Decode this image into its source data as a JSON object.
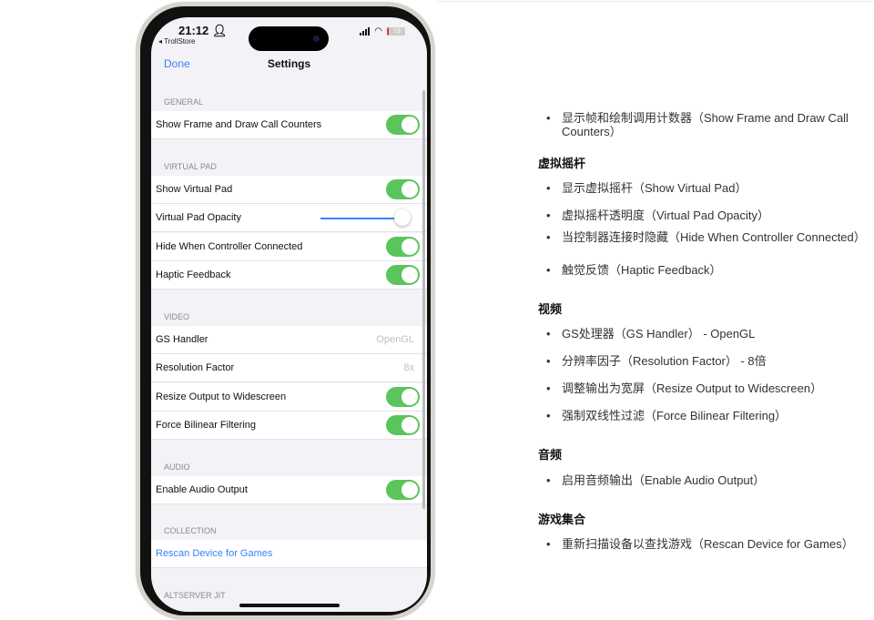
{
  "status": {
    "time": "21:12",
    "back": "◂ TrollStore",
    "battery": "13"
  },
  "nav": {
    "done": "Done",
    "title": "Settings"
  },
  "sections": [
    {
      "header": "GENERAL",
      "rows": [
        {
          "label": "Show Frame and Draw Call Counters",
          "toggle": true
        }
      ]
    },
    {
      "header": "VIRTUAL PAD",
      "rows": [
        {
          "label": "Show Virtual Pad",
          "toggle": true
        },
        {
          "label": "Virtual Pad Opacity",
          "slider": 1.0
        },
        {
          "label": "Hide When Controller Connected",
          "toggle": true
        },
        {
          "label": "Haptic Feedback",
          "toggle": true
        }
      ]
    },
    {
      "header": "VIDEO",
      "rows": [
        {
          "label": "GS Handler",
          "value": "OpenGL"
        },
        {
          "label": "Resolution Factor",
          "value": "8x"
        },
        {
          "label": "Resize Output to Widescreen",
          "toggle": true
        },
        {
          "label": "Force Bilinear Filtering",
          "toggle": true
        }
      ]
    },
    {
      "header": "AUDIO",
      "rows": [
        {
          "label": "Enable Audio Output",
          "toggle": true
        }
      ]
    },
    {
      "header": "COLLECTION",
      "rows": [
        {
          "label": "Rescan Device for Games"
        }
      ]
    },
    {
      "header": "ALTSERVER JIT",
      "rows": []
    }
  ],
  "doc": {
    "items": [
      {
        "type": "li",
        "text": "显示帧和绘制调用计数器（Show Frame and Draw Call Counters）"
      },
      {
        "type": "h",
        "text": "虚拟摇杆"
      },
      {
        "type": "li",
        "text": "显示虚拟摇杆（Show Virtual Pad）"
      },
      {
        "type": "li",
        "text": "虚拟摇杆透明度（Virtual Pad Opacity）"
      },
      {
        "type": "li",
        "text": "当控制器连接时隐藏（Hide When Controller Connected）"
      },
      {
        "type": "li",
        "text": "触觉反馈（Haptic Feedback）"
      },
      {
        "type": "h",
        "text": "视频"
      },
      {
        "type": "li",
        "text": "GS处理器（GS Handler） - OpenGL"
      },
      {
        "type": "li",
        "text": "分辨率因子（Resolution Factor） - 8倍"
      },
      {
        "type": "li",
        "text": "调整输出为宽屏（Resize Output to Widescreen）"
      },
      {
        "type": "li",
        "text": "强制双线性过滤（Force Bilinear Filtering）"
      },
      {
        "type": "h",
        "text": "音频"
      },
      {
        "type": "li",
        "text": "启用音频输出（Enable Audio Output）"
      },
      {
        "type": "h",
        "text": "游戏集合"
      },
      {
        "type": "li",
        "text": "重新扫描设备以查找游戏（Rescan Device for Games）"
      }
    ]
  },
  "colors": {
    "accent": "#3a82f7",
    "toggle_on": "#5ac55a"
  }
}
